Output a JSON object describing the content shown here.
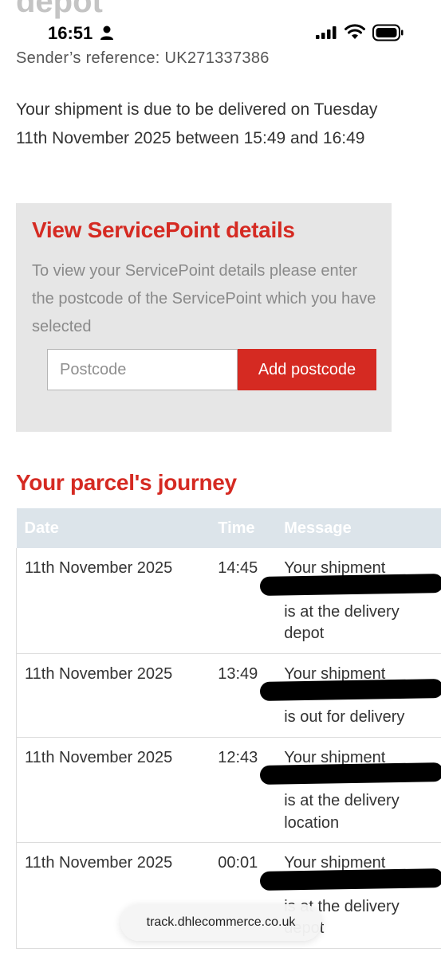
{
  "background_heading": "depot",
  "status_bar": {
    "time": "16:51",
    "icons": [
      "person-icon",
      "signal-icon",
      "wifi-icon",
      "battery-icon"
    ]
  },
  "sender_reference": "Sender’s reference: UK271337386",
  "delivery_message": "Your shipment is due to be delivered on Tuesday 11th November 2025 between 15:49 and 16:49",
  "service_point": {
    "title": "View ServicePoint details",
    "description": "To view your ServicePoint details please enter the postcode of the ServicePoint which you have selected",
    "postcode_placeholder": "Postcode",
    "postcode_value": "",
    "button_label": "Add postcode"
  },
  "journey": {
    "title": "Your parcel's journey",
    "headers": {
      "date": "Date",
      "time": "Time",
      "message": "Message"
    },
    "rows": [
      {
        "date": "11th November 2025",
        "time": "14:45",
        "message_start": "Your shipment",
        "message_end": "is at the delivery depot"
      },
      {
        "date": "11th November 2025",
        "time": "13:49",
        "message_start": "Your shipment",
        "message_end": "is out for delivery"
      },
      {
        "date": "11th November 2025",
        "time": "12:43",
        "message_start": "Your shipment",
        "message_end": "is at the delivery location"
      },
      {
        "date": "11th November 2025",
        "time": "00:01",
        "message_start": "Your shipment",
        "message_end": "is at the delivery depot"
      }
    ]
  },
  "browser": {
    "url": "track.dhlecommerce.co.uk"
  },
  "colors": {
    "accent": "#d52a22",
    "panel_bg": "#e6e6e6",
    "table_header_bg": "#dce4ea"
  }
}
